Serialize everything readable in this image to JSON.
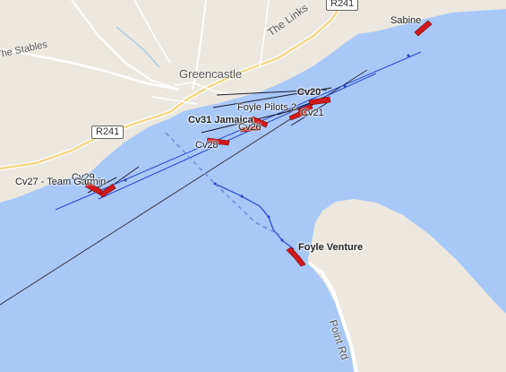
{
  "map": {
    "place_labels": {
      "greencastle": "Greencastle",
      "the_links": "The Links",
      "the_stables": "The Stables",
      "point_rd": "Point Rd"
    },
    "road_shields": [
      "R241",
      "R241"
    ],
    "vessels": [
      {
        "id": "sabine",
        "label": "Sabine"
      },
      {
        "id": "cv20",
        "label": "Cv20"
      },
      {
        "id": "foyle-pilots",
        "label": "Foyle Pilots 2"
      },
      {
        "id": "cv21",
        "label": "Cv21"
      },
      {
        "id": "cv31",
        "label": "Cv31 Jamaica"
      },
      {
        "id": "cv-unk",
        "label": "Cv26"
      },
      {
        "id": "cv28",
        "label": "Cv28"
      },
      {
        "id": "cv29",
        "label": "Cv29"
      },
      {
        "id": "cv27",
        "label": "Cv27 - Team Garmin"
      },
      {
        "id": "foyle-venture",
        "label": "Foyle Venture"
      }
    ],
    "colors": {
      "water": "#a8c8f8",
      "land": "#ece8df",
      "vessel": "#d11a1a",
      "track": "#2244cc",
      "road": "#ffffff"
    }
  }
}
